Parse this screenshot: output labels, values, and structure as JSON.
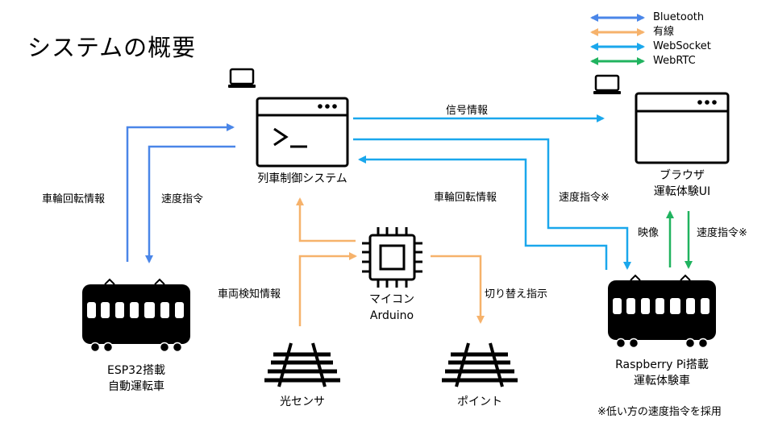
{
  "title": "システムの概要",
  "legend": [
    {
      "label": "Bluetooth",
      "color": "#4a86e8"
    },
    {
      "label": "有線",
      "color": "#f6b26b"
    },
    {
      "label": "WebSocket",
      "color": "#1aa7ec"
    },
    {
      "label": "WebRTC",
      "color": "#20b35f"
    }
  ],
  "nodes": {
    "train_control": {
      "label": "列車制御システム",
      "icons": [
        "laptop-icon",
        "terminal-icon"
      ]
    },
    "browser": {
      "label1": "ブラウザ",
      "label2": "運転体験UI",
      "icons": [
        "laptop-icon",
        "browser-window-icon"
      ]
    },
    "microcontroller": {
      "label1": "マイコン",
      "label2": "Arduino",
      "icon": "chip-icon"
    },
    "esp_train": {
      "label1": "ESP32搭載",
      "label2": "自動運転車",
      "icon": "train-icon"
    },
    "raspi_train": {
      "label1": "Raspberry Pi搭載",
      "label2": "運転体験車",
      "icon": "train-icon"
    },
    "light_sensor": {
      "label": "光センサ",
      "icon": "rail-track-icon"
    },
    "point": {
      "label": "ポイント",
      "icon": "rail-track-icon"
    }
  },
  "edges": {
    "wheel_rotation_left": "車輪回転情報",
    "speed_cmd_left": "速度指令",
    "signal_info": "信号情報",
    "wheel_rotation_right": "車輪回転情報",
    "speed_cmd_right": "速度指令※",
    "video": "映像",
    "speed_cmd_ui": "速度指令※",
    "vehicle_detect": "車両検知情報",
    "switch_cmd": "切り替え指示"
  },
  "footnote": "※低い方の速度指令を採用"
}
